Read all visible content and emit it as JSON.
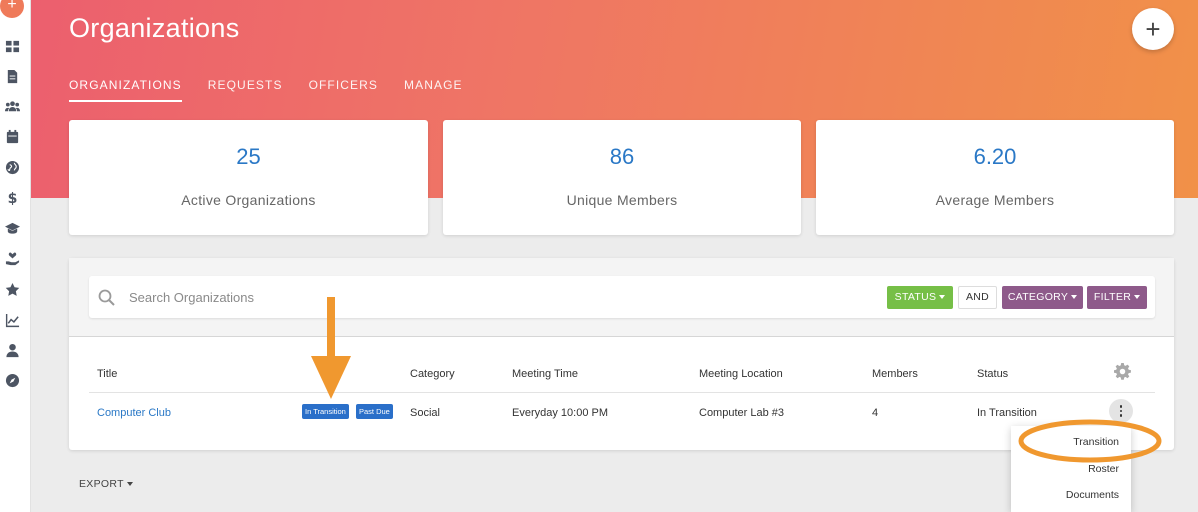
{
  "page": {
    "title": "Organizations",
    "add_button": "+"
  },
  "tabs": [
    {
      "label": "ORGANIZATIONS",
      "active": true
    },
    {
      "label": "REQUESTS",
      "active": false
    },
    {
      "label": "OFFICERS",
      "active": false
    },
    {
      "label": "MANAGE",
      "active": false
    }
  ],
  "sidebar": {
    "add_label": "+",
    "icons": [
      "dashboard-icon",
      "document-icon",
      "users-icon",
      "calendar-icon",
      "globe-icon",
      "dollar-icon",
      "graduation-cap-icon",
      "hand-heart-icon",
      "star-icon",
      "chart-icon",
      "user-icon",
      "compass-icon"
    ]
  },
  "stats": [
    {
      "value": "25",
      "label": "Active Organizations"
    },
    {
      "value": "86",
      "label": "Unique Members"
    },
    {
      "value": "6.20",
      "label": "Average Members"
    }
  ],
  "search": {
    "placeholder": "Search Organizations",
    "value": ""
  },
  "filters": {
    "status": "STATUS",
    "and": "AND",
    "category": "CATEGORY",
    "filter": "FILTER",
    "colors": {
      "status": "#76bf47",
      "category": "#8e5a8a",
      "filter": "#8e5a8a"
    }
  },
  "table": {
    "headers": [
      "Title",
      "Category",
      "Meeting Time",
      "Meeting Location",
      "Members",
      "Status"
    ],
    "rows": [
      {
        "title": "Computer Club",
        "badges": [
          "In Transition",
          "Past Due"
        ],
        "category": "Social",
        "meeting_time": "Everyday 10:00 PM",
        "meeting_location": "Computer Lab #3",
        "members": "4",
        "status": "In Transition"
      }
    ]
  },
  "row_menu": {
    "items": [
      "Transition",
      "Roster",
      "Documents"
    ],
    "highlighted": "Transition"
  },
  "export": {
    "label": "EXPORT"
  },
  "colors": {
    "accent": "#2a78c6",
    "annotation": "#f0982f",
    "header_start": "#ec5f6e",
    "header_end": "#f19148"
  }
}
